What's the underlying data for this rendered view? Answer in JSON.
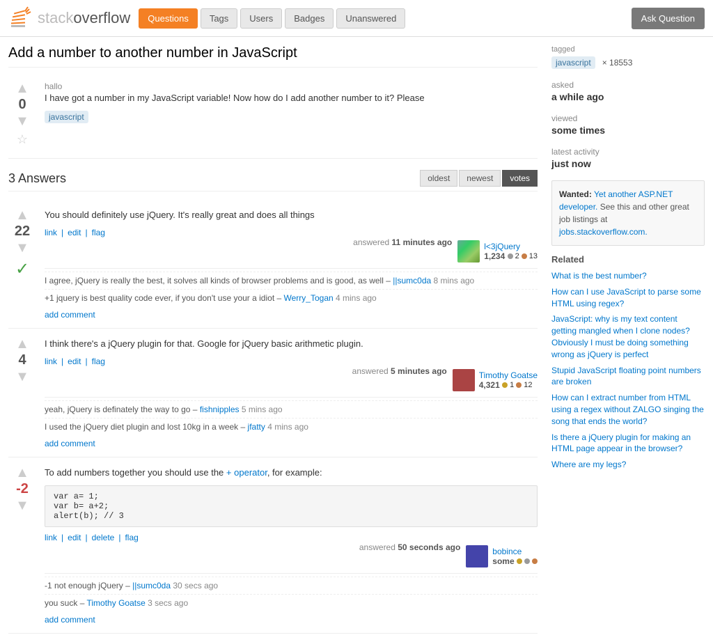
{
  "header": {
    "logo_text": "stackoverflow",
    "nav": [
      "Questions",
      "Tags",
      "Users",
      "Badges",
      "Unanswered"
    ],
    "active_nav": "Questions",
    "ask_button": "Ask Question"
  },
  "question": {
    "title": "Add a number to another number in JavaScript",
    "votes": "0",
    "author": "hallo",
    "text": "I have got a number in my JavaScript variable! Now how do I add another number to it? Please",
    "tags": [
      "javascript"
    ],
    "asked_label": "asked",
    "asked_time": "a while ago",
    "viewed_label": "viewed",
    "viewed_count": "some times",
    "latest_label": "latest activity",
    "latest_time": "just now",
    "tagged_label": "tagged",
    "tag_name": "javascript",
    "tag_count": "× 18553"
  },
  "answers": {
    "count_label": "3 Answers",
    "sort_oldest": "oldest",
    "sort_newest": "newest",
    "sort_votes": "votes",
    "items": [
      {
        "votes": "22",
        "accepted": true,
        "text": "You should definitely use jQuery. It's really great and does all things",
        "actions": [
          "link",
          "edit",
          "flag"
        ],
        "answered_text": "answered",
        "answered_time": "11 minutes ago",
        "user_name": "l<3jQuery",
        "user_rep": "1,234",
        "badges_gold": "2",
        "badges_bronze": "13",
        "comments": [
          {
            "text": "I agree, jQuery is really the best, it solves all kinds of browser problems and is good, as well –",
            "author": "||sumc0da",
            "time": "8 mins ago"
          },
          {
            "text": "+1 jquery is best quality code ever, if you don't use your a idiot –",
            "author": "Werry_Togan",
            "time": "4 mins ago"
          }
        ],
        "add_comment": "add comment"
      },
      {
        "votes": "4",
        "accepted": false,
        "text": "I think there's a jQuery plugin for that. Google for jQuery basic arithmetic plugin.",
        "actions": [
          "link",
          "edit",
          "flag"
        ],
        "answered_text": "answered",
        "answered_time": "5 minutes ago",
        "user_name": "Timothy Goatse",
        "user_rep": "4,321",
        "badges_gold": "1",
        "badges_bronze": "12",
        "comments": [
          {
            "text": "yeah, jQuery is definately the way to go –",
            "author": "fishnipples",
            "time": "5 mins ago"
          },
          {
            "text": "I used the jQuery diet plugin and lost 10kg in a week –",
            "author": "jfatty",
            "time": "4 mins ago"
          }
        ],
        "add_comment": "add comment"
      },
      {
        "votes": "-2",
        "accepted": false,
        "text": "To add numbers together you should use the",
        "operator": "+ operator",
        "text2": ", for example:",
        "code": "var a= 1;\nvar b= a+2;\nalert(b); // 3",
        "actions": [
          "link",
          "edit",
          "delete",
          "flag"
        ],
        "answered_text": "answered",
        "answered_time": "50 seconds ago",
        "user_name": "bobince",
        "user_rep": "some",
        "badges_gold": "",
        "badges_bronze": "",
        "comments": [
          {
            "text": "-1 not enough jQuery –",
            "author": "||sumc0da",
            "time": "30 secs ago"
          },
          {
            "text": "you suck –",
            "author": "Timothy Goatse",
            "time": "3 secs ago"
          }
        ],
        "add_comment": "add comment"
      }
    ]
  },
  "sidebar": {
    "tagged_label": "tagged",
    "tag": "javascript",
    "tag_count": "× 18553",
    "asked_label": "asked",
    "asked_value": "a while ago",
    "viewed_label": "viewed",
    "viewed_value": "some times",
    "latest_label": "latest activity",
    "latest_value": "just now",
    "ad": {
      "wanted": "Wanted:",
      "text": "Yet another ASP.NET developer.",
      "see": "See this",
      "and": "and other great job listings at",
      "link": "jobs.stackoverflow.com."
    },
    "related_title": "Related",
    "related_items": [
      {
        "text": "What is the best number?"
      },
      {
        "text": "How can I use JavaScript to parse some HTML using regex?"
      },
      {
        "text": "JavaScript: why is my text content getting mangled when I clone nodes? Obviously I must be doing something wrong as jQuery is perfect"
      },
      {
        "text": "Stupid JavaScript floating point numbers are broken"
      },
      {
        "text": "How can I extract number from HTML using a regex without ZALGO singing the song that ends the world?"
      },
      {
        "text": "Is there a jQuery plugin for making an HTML page appear in the browser?"
      },
      {
        "text": "Where are my legs?"
      }
    ]
  }
}
